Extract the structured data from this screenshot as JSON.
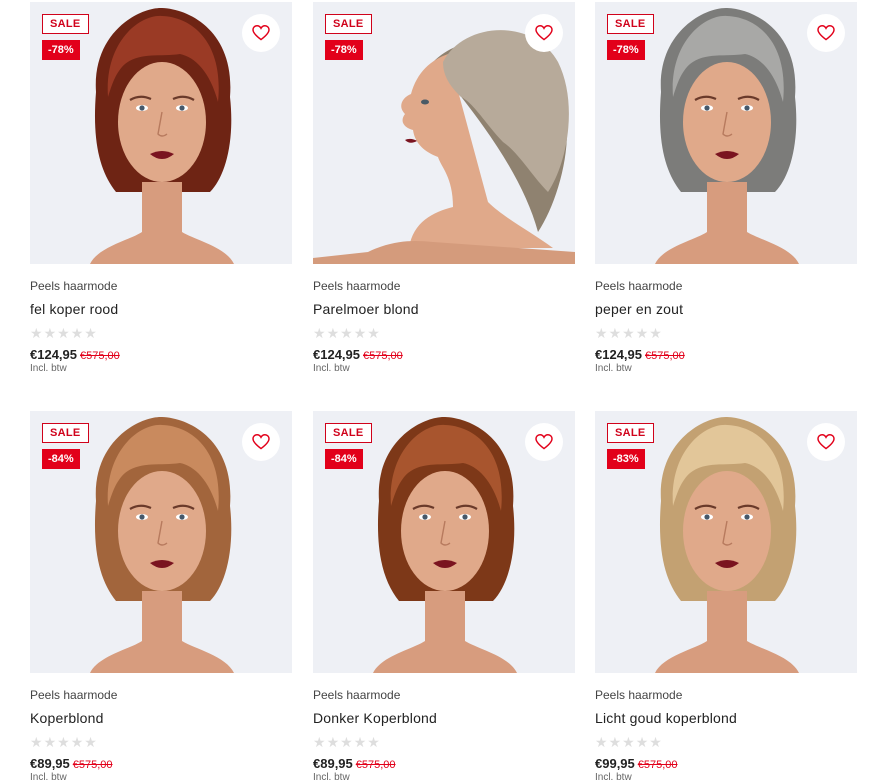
{
  "products": [
    {
      "brand": "Peels haarmode",
      "name": "fel koper rood",
      "sale": "SALE",
      "discount": "-78%",
      "price": "€124,95",
      "old_price": "€575,00",
      "vat": "Incl. btw",
      "hair": "#9a3a25",
      "hair_dark": "#6e2414",
      "pose": "front"
    },
    {
      "brand": "Peels haarmode",
      "name": "Parelmoer blond",
      "sale": "SALE",
      "discount": "-78%",
      "price": "€124,95",
      "old_price": "€575,00",
      "vat": "Incl. btw",
      "hair": "#b7aa9a",
      "hair_dark": "#8f8270",
      "pose": "profile"
    },
    {
      "brand": "Peels haarmode",
      "name": "peper en zout",
      "sale": "SALE",
      "discount": "-78%",
      "price": "€124,95",
      "old_price": "€575,00",
      "vat": "Incl. btw",
      "hair": "#a8a8a6",
      "hair_dark": "#7c7c7a",
      "pose": "front"
    },
    {
      "brand": "Peels haarmode",
      "name": "Koperblond",
      "sale": "SALE",
      "discount": "-84%",
      "price": "€89,95",
      "old_price": "€575,00",
      "vat": "Incl. btw",
      "hair": "#c98a5e",
      "hair_dark": "#a2653c",
      "pose": "front"
    },
    {
      "brand": "Peels haarmode",
      "name": "Donker Koperblond",
      "sale": "SALE",
      "discount": "-84%",
      "price": "€89,95",
      "old_price": "€575,00",
      "vat": "Incl. btw",
      "hair": "#a8552e",
      "hair_dark": "#7d3818",
      "pose": "front"
    },
    {
      "brand": "Peels haarmode",
      "name": "Licht goud koperblond",
      "sale": "SALE",
      "discount": "-83%",
      "price": "€99,95",
      "old_price": "€575,00",
      "vat": "Incl. btw",
      "hair": "#e2c699",
      "hair_dark": "#c3a172",
      "pose": "front"
    }
  ],
  "rating": {
    "filled": 0,
    "max": 5
  },
  "colors": {
    "accent": "#e2001a",
    "background": "#eef0f5",
    "skin": "#e0a98a"
  },
  "icons": {
    "wishlist": "heart-outline-icon",
    "rating": "star-icon"
  }
}
